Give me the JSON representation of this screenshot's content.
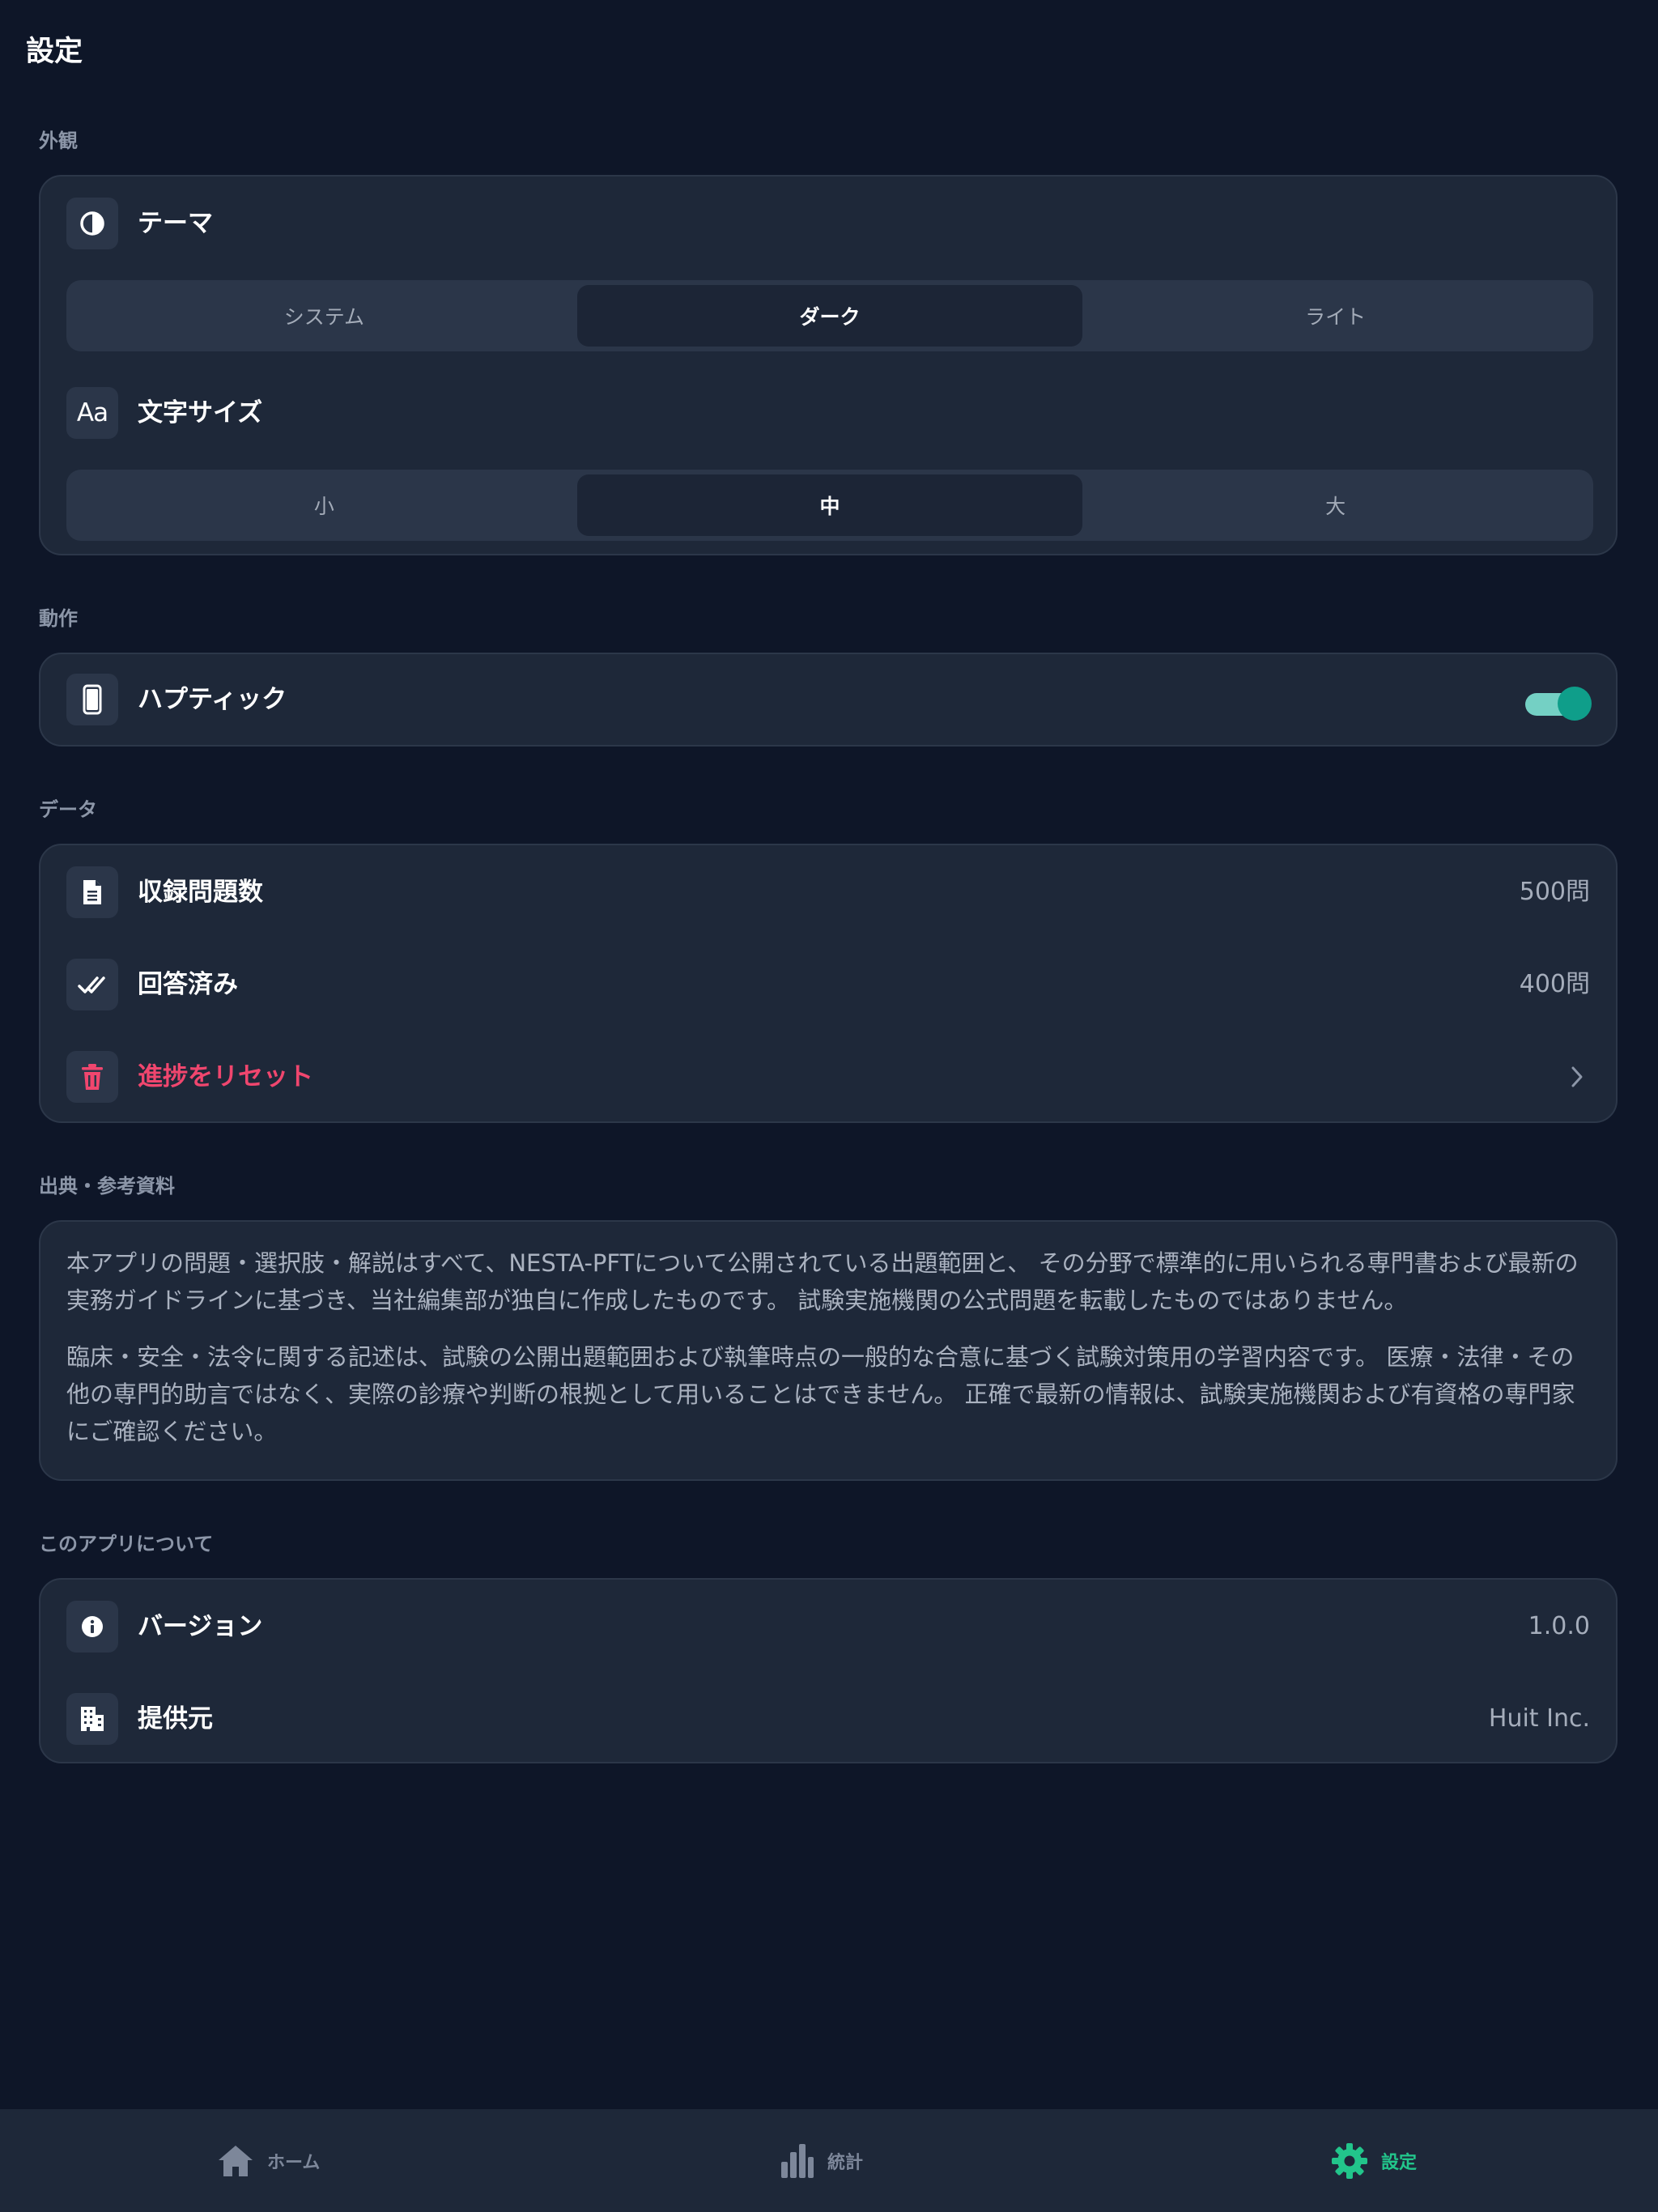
{
  "title": "設定",
  "sections": {
    "appearance": {
      "header": "外観",
      "theme": {
        "label": "テーマ",
        "icon": "contrast-icon",
        "options": [
          "システム",
          "ダーク",
          "ライト"
        ],
        "selected": "ダーク"
      },
      "font_size": {
        "label": "文字サイズ",
        "icon_text": "Aa",
        "options": [
          "小",
          "中",
          "大"
        ],
        "selected": "中"
      }
    },
    "behavior": {
      "header": "動作",
      "haptic": {
        "label": "ハプティック",
        "icon": "phone-icon",
        "enabled": true
      }
    },
    "data": {
      "header": "データ",
      "question_count": {
        "label": "収録問題数",
        "value": "500問",
        "icon": "document-icon"
      },
      "answered": {
        "label": "回答済み",
        "value": "400問",
        "icon": "double-check-icon"
      },
      "reset": {
        "label": "進捗をリセット",
        "icon": "trash-icon"
      }
    },
    "sources": {
      "header": "出典・参考資料",
      "paragraphs": [
        "本アプリの問題・選択肢・解説はすべて、NESTA-PFTについて公開されている出題範囲と、 その分野で標準的に用いられる専門書および最新の実務ガイドラインに基づき、当社編集部が独自に作成したものです。 試験実施機関の公式問題を転載したものではありません。",
        "臨床・安全・法令に関する記述は、試験の公開出題範囲および執筆時点の一般的な合意に基づく試験対策用の学習内容です。 医療・法律・その他の専門的助言ではなく、実際の診療や判断の根拠として用いることはできません。 正確で最新の情報は、試験実施機関および有資格の専門家にご確認ください。"
      ]
    },
    "about": {
      "header": "このアプリについて",
      "version": {
        "label": "バージョン",
        "value": "1.0.0",
        "icon": "info-icon"
      },
      "provider": {
        "label": "提供元",
        "value": "Huit Inc.",
        "icon": "building-icon"
      }
    }
  },
  "tabbar": {
    "tabs": [
      {
        "label": "ホーム",
        "icon": "home-icon"
      },
      {
        "label": "統計",
        "icon": "chart-icon"
      },
      {
        "label": "設定",
        "icon": "gear-icon"
      }
    ],
    "active": "設定"
  },
  "colors": {
    "background": "#0e1628",
    "card": "#1e2839",
    "danger": "#f0466e",
    "accent": "#22c58b",
    "toggle": "#0f9e8a"
  }
}
